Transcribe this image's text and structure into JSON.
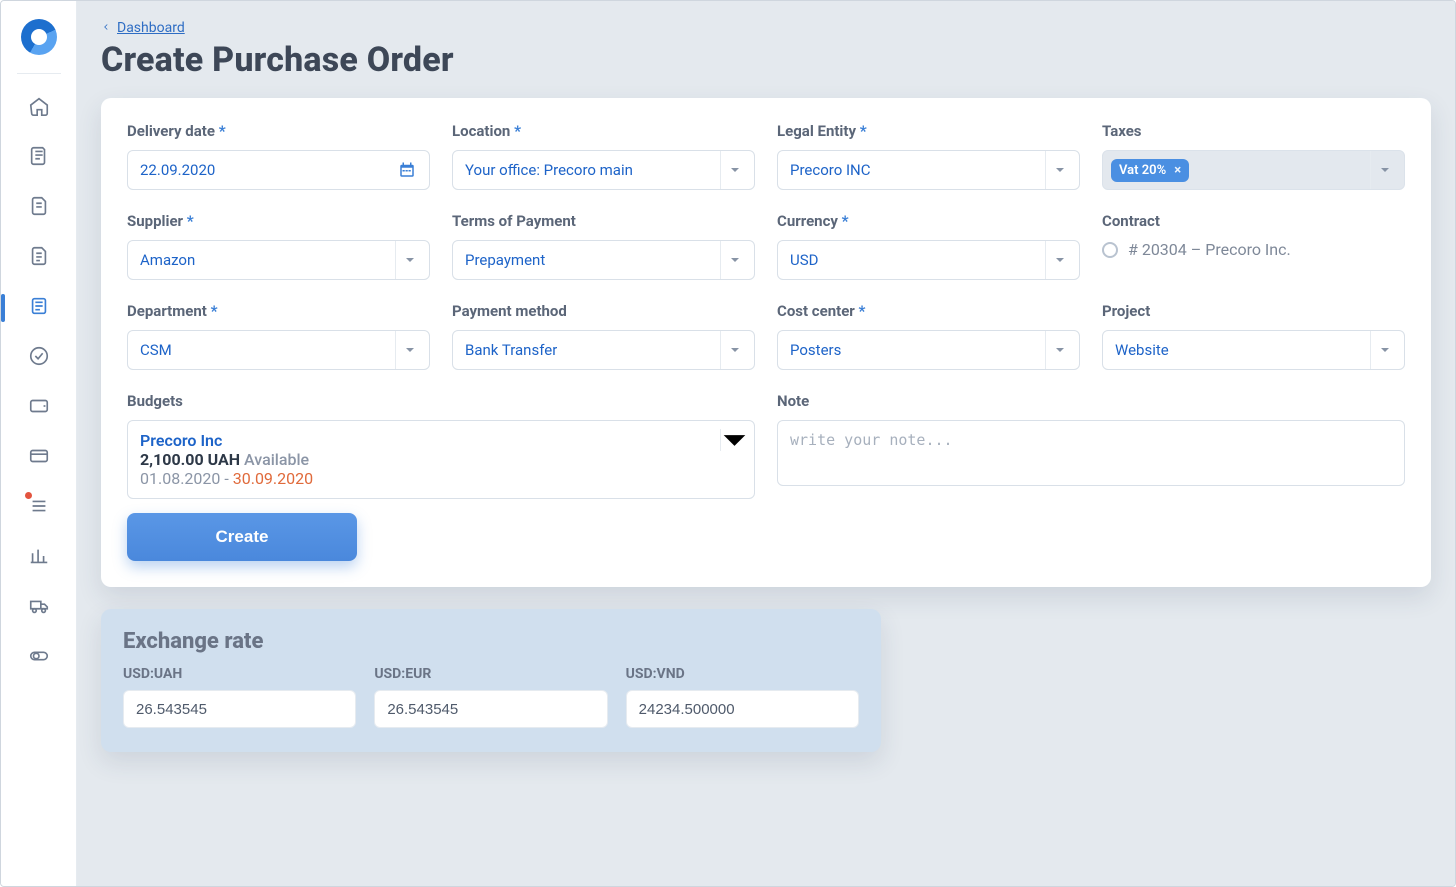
{
  "breadcrumb": {
    "label": "Dashboard"
  },
  "title": "Create Purchase Order",
  "fields": {
    "delivery_date": {
      "label": "Delivery date",
      "value": "22.09.2020"
    },
    "location": {
      "label": "Location",
      "value": "Your office: Precoro main"
    },
    "legal_entity": {
      "label": "Legal Entity",
      "value": "Precoro INC"
    },
    "taxes": {
      "label": "Taxes",
      "chip": "Vat 20%"
    },
    "supplier": {
      "label": "Supplier",
      "value": "Amazon"
    },
    "terms": {
      "label": "Terms of Payment",
      "value": "Prepayment"
    },
    "currency": {
      "label": "Currency",
      "value": "USD"
    },
    "contract": {
      "label": "Contract",
      "option": "# 20304 – Precoro Inc."
    },
    "department": {
      "label": "Department",
      "value": "CSM"
    },
    "payment_method": {
      "label": "Payment method",
      "value": "Bank Transfer"
    },
    "cost_center": {
      "label": "Cost center",
      "value": "Posters"
    },
    "project": {
      "label": "Project",
      "value": "Website"
    },
    "budgets": {
      "label": "Budgets",
      "name": "Precoro Inc",
      "amount": "2,100.00 UAH",
      "available_word": "Available",
      "period_start": "01.08.2020",
      "period_end": "30.09.2020"
    },
    "note": {
      "label": "Note",
      "placeholder": "write your note..."
    }
  },
  "actions": {
    "create": "Create"
  },
  "exchange": {
    "title": "Exchange rate",
    "pairs": [
      {
        "label": "USD:UAH",
        "value": "26.543545"
      },
      {
        "label": "USD:EUR",
        "value": "26.543545"
      },
      {
        "label": "USD:VND",
        "value": "24234.500000"
      }
    ]
  },
  "sidebar": {
    "items": [
      "home",
      "request",
      "doc-1",
      "doc-2",
      "po",
      "approval",
      "wallet",
      "card",
      "list",
      "analytics",
      "shipping",
      "toggle"
    ],
    "active_index": 4,
    "dot_index": 8
  }
}
